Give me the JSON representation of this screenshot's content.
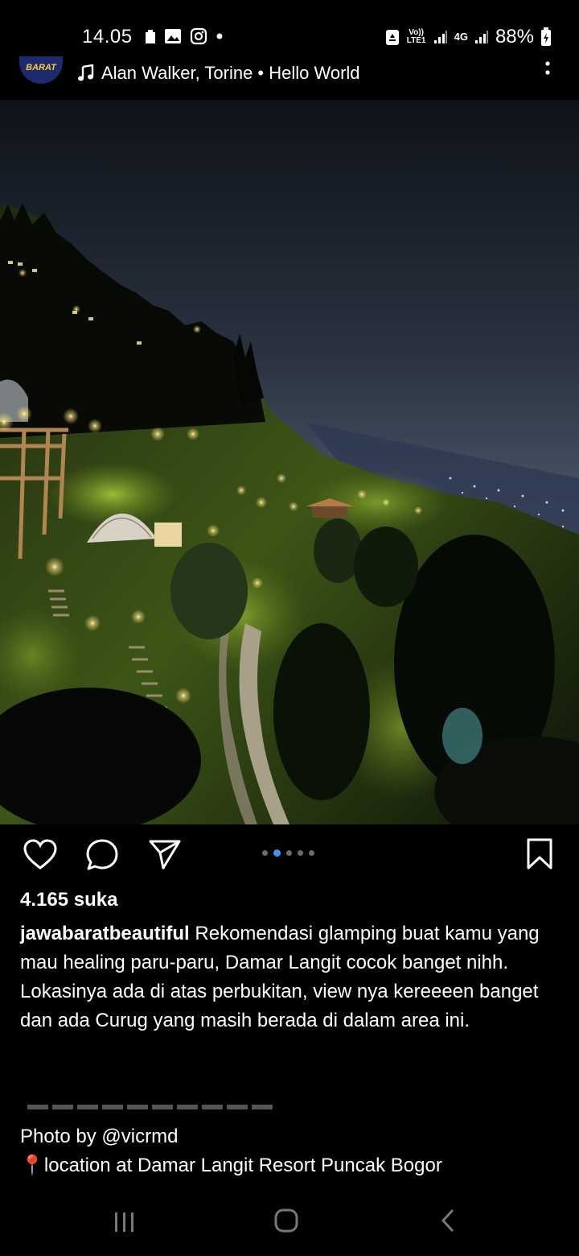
{
  "status_bar": {
    "time": "14.05",
    "volte_label": "Vo)) LTE1",
    "network_label": "4G",
    "battery": "88%"
  },
  "post": {
    "account_logo_text": "BARAT",
    "music": "Alan Walker, Torine • Hello World",
    "likes": "4.165 suka",
    "username": "jawabaratbeautiful",
    "caption": "Rekomendasi glamping buat kamu yang mau healing paru-paru, Damar Langit cocok banget nihh. Lokasinya ada di atas perbukitan, view nya kereeeen banget dan ada Curug yang masih berada di dalam area ini.",
    "photo_credit": "Photo by @vicrmd",
    "location": "📍location at Damar Langit Resort Puncak Bogor",
    "carousel_total": 5,
    "carousel_current": 2
  },
  "icons": {
    "like": "heart-icon",
    "comment": "comment-icon",
    "share": "send-icon",
    "save": "bookmark-icon",
    "more": "more-vertical-icon",
    "music": "music-note-icon"
  },
  "colors": {
    "background": "#000000",
    "text": "#ffffff",
    "carousel_active": "#3897f0",
    "carousel_inactive": "#6b6b6b"
  }
}
